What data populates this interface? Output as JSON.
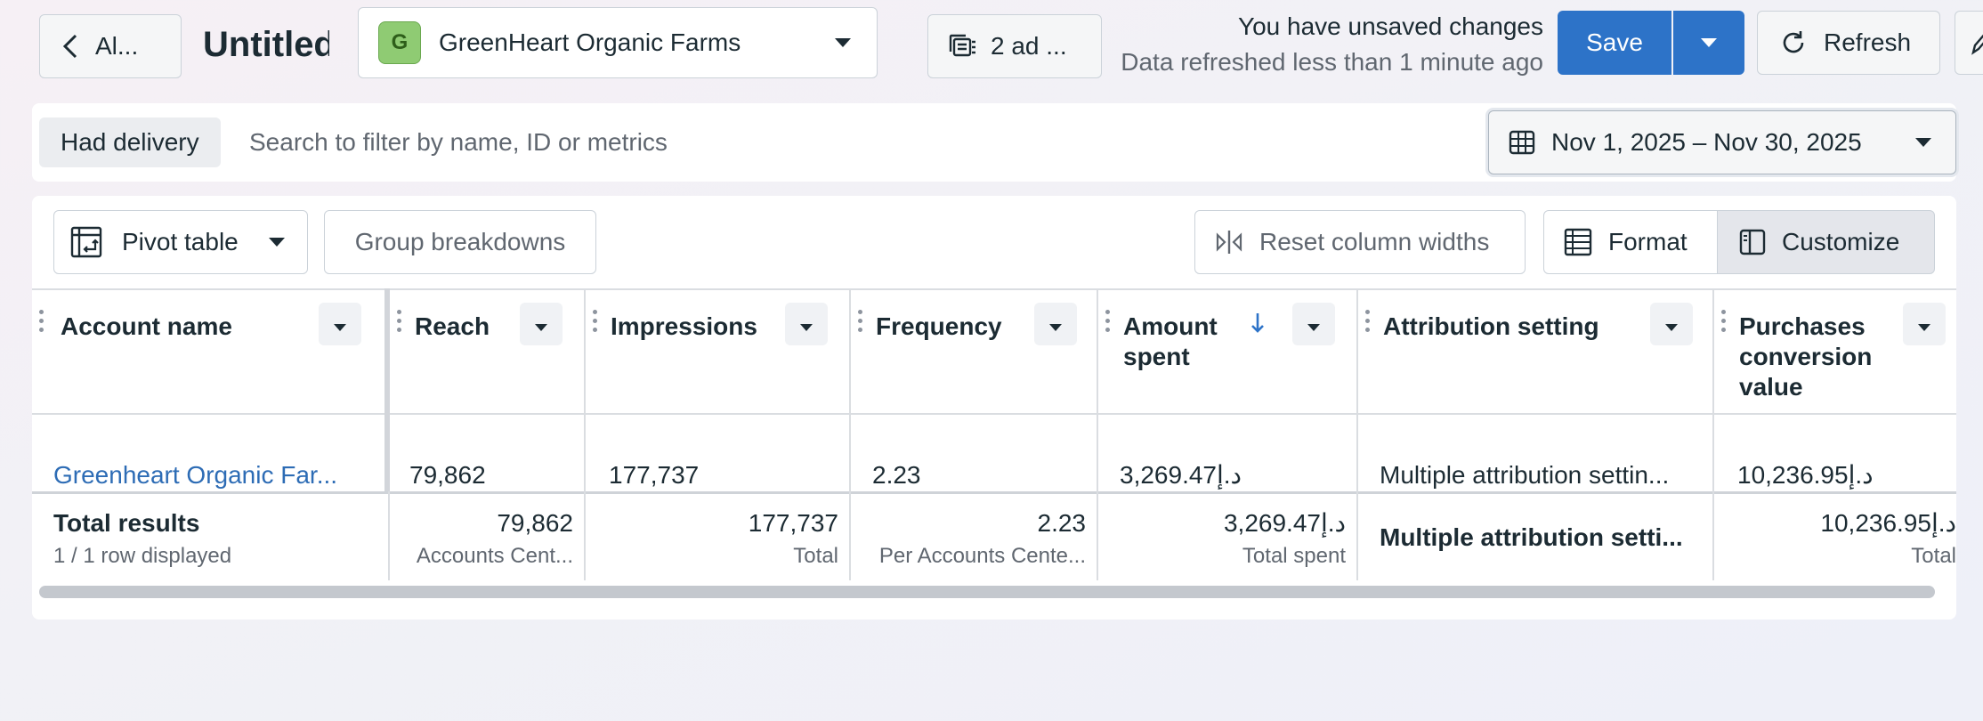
{
  "topbar": {
    "back_label": "Al...",
    "report_title": "Untitled",
    "account": {
      "avatar_letter": "G",
      "name": "GreenHeart Organic Farms"
    },
    "ads_label": "2 ad ...",
    "unsaved_text": "You have unsaved changes",
    "refreshed_text": "Data refreshed less than 1 minute ago",
    "save_label": "Save",
    "refresh_label": "Refresh"
  },
  "filters": {
    "chip_label": "Had delivery",
    "search_placeholder": "Search to filter by name, ID or metrics",
    "date_range": "Nov 1, 2025 – Nov 30, 2025"
  },
  "toolbar": {
    "pivot_label": "Pivot table",
    "group_label": "Group breakdowns",
    "reset_label": "Reset column widths",
    "format_label": "Format",
    "customize_label": "Customize"
  },
  "table": {
    "columns": [
      {
        "label": "Account name"
      },
      {
        "label": "Reach"
      },
      {
        "label": "Impressions"
      },
      {
        "label": "Frequency"
      },
      {
        "label": "Amount spent"
      },
      {
        "label": "Attribution setting"
      },
      {
        "label": "Purchases conversion value"
      }
    ],
    "rows": [
      {
        "cells": [
          "Greenheart Organic Far...",
          "79,862",
          "177,737",
          "2.23",
          "3,269.47د.إ",
          "Multiple attribution settin...",
          "10,236.95د.إ"
        ]
      }
    ],
    "totals": {
      "label": "Total results",
      "rows_displayed": "1 / 1 row displayed",
      "values": [
        "79,862",
        "177,737",
        "2.23",
        "3,269.47د.إ",
        "Multiple attribution setti...",
        "10,236.95د.إ"
      ],
      "subs": [
        "Accounts Cent...",
        "Total",
        "Per Accounts Cente...",
        "Total spent",
        "",
        "Total"
      ]
    }
  },
  "colors": {
    "accent": "#2d73c8",
    "link": "#2d6cb5"
  }
}
